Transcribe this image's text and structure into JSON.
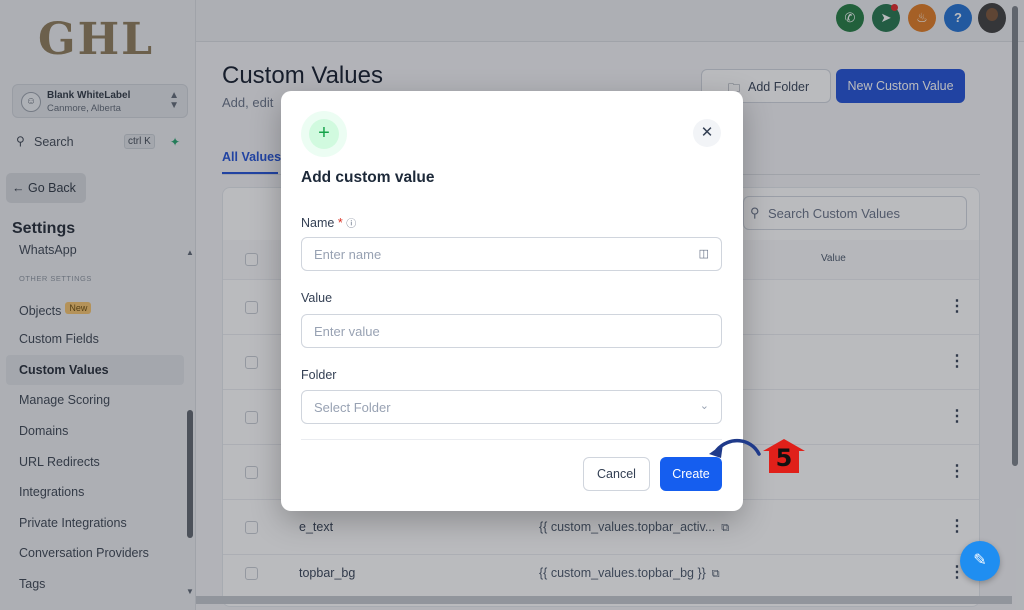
{
  "app": {
    "logo": "GHL"
  },
  "account": {
    "name": "Blank WhiteLabel",
    "location": "Canmore, Alberta",
    "avatar_icon": "user-icon"
  },
  "search": {
    "label": "Search",
    "shortcut": "ctrl K"
  },
  "sidebar": {
    "go_back": "Go Back",
    "title": "Settings",
    "section_other": "OTHER SETTINGS",
    "items": [
      {
        "label": "WhatsApp"
      },
      {
        "label": "Objects",
        "badge": "New"
      },
      {
        "label": "Custom Fields"
      },
      {
        "label": "Custom Values"
      },
      {
        "label": "Manage Scoring"
      },
      {
        "label": "Domains"
      },
      {
        "label": "URL Redirects"
      },
      {
        "label": "Integrations"
      },
      {
        "label": "Private Integrations"
      },
      {
        "label": "Conversation Providers"
      },
      {
        "label": "Tags"
      }
    ]
  },
  "topbar": {
    "help_label": "?",
    "colors": {
      "phone": "#1f7a3f",
      "megaphone": "#21734a",
      "bell": "#e07a1f",
      "help": "#1f6fd1"
    }
  },
  "page": {
    "title": "Custom Values",
    "subtitle": "Add, edit",
    "add_folder": "Add Folder",
    "new_value": "New Custom Value",
    "tab_all": "All Values"
  },
  "table": {
    "search_placeholder": "Search Custom Values",
    "col_value": "Value",
    "rows": [
      {
        "name": "",
        "value": ""
      },
      {
        "name": "",
        "value": ""
      },
      {
        "name": "",
        "value": ""
      },
      {
        "name": "",
        "value": ""
      },
      {
        "name": "e_text",
        "value": "{{ custom_values.topbar_activ..."
      },
      {
        "name": "topbar_bg",
        "value": "{{ custom_values.topbar_bg }}"
      }
    ]
  },
  "modal": {
    "title": "Add custom value",
    "name_label": "Name",
    "name_required": "*",
    "name_placeholder": "Enter name",
    "value_label": "Value",
    "value_placeholder": "Enter value",
    "folder_label": "Folder",
    "folder_placeholder": "Select Folder",
    "cancel": "Cancel",
    "create": "Create"
  },
  "annotation": {
    "step": "5",
    "color": "#e0201a",
    "arrow_color": "#1f3a8a"
  },
  "colors": {
    "primary": "#155eef",
    "accent_green": "#16a34a"
  }
}
